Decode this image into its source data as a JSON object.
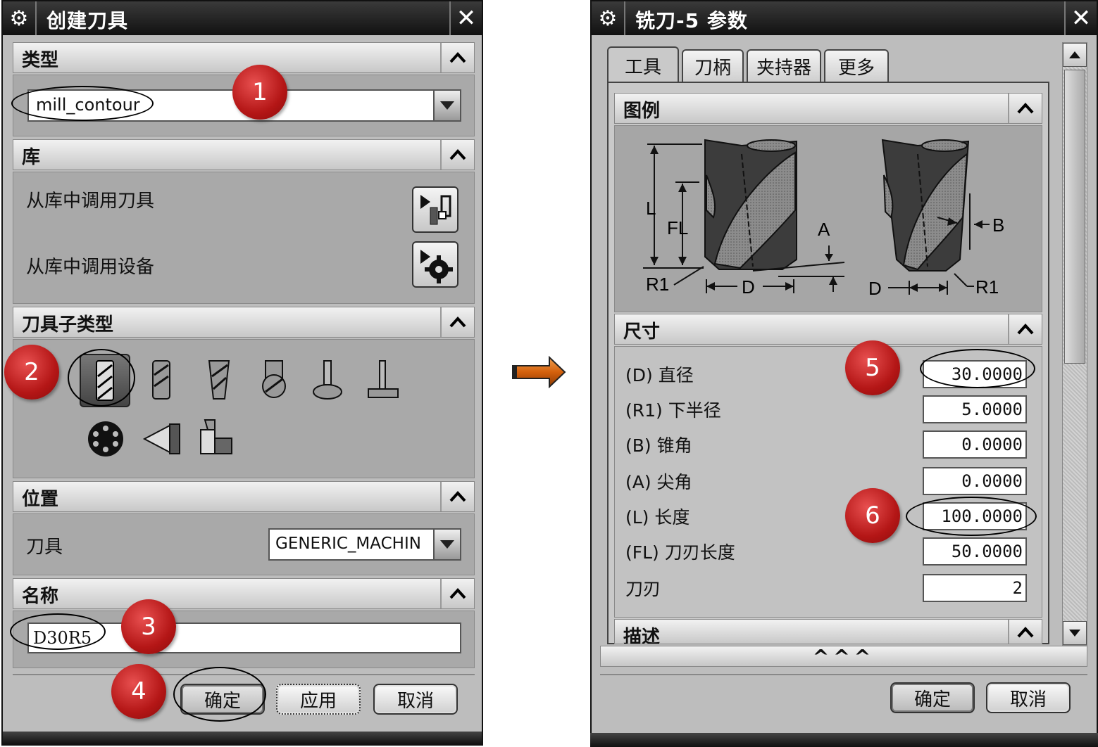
{
  "left_dialog": {
    "title": "创建刀具",
    "sections": {
      "type": {
        "title": "类型",
        "value": "mill_contour"
      },
      "library": {
        "title": "库",
        "retrieve_tool": "从库中调用刀具",
        "retrieve_device": "从库中调用设备"
      },
      "subtype": {
        "title": "刀具子类型"
      },
      "location": {
        "title": "位置",
        "tool_label": "刀具",
        "tool_value": "GENERIC_MACHIN"
      },
      "name": {
        "title": "名称",
        "value": "D30R5"
      }
    },
    "buttons": {
      "ok": "确定",
      "apply": "应用",
      "cancel": "取消"
    }
  },
  "right_dialog": {
    "title": "铣刀-5 参数",
    "tabs": [
      "工具",
      "刀柄",
      "夹持器",
      "更多"
    ],
    "sections": {
      "legend": {
        "title": "图例"
      },
      "dimensions": {
        "title": "尺寸"
      },
      "description": {
        "title": "描述"
      }
    },
    "params": [
      {
        "label": "(D) 直径",
        "value": "30.0000"
      },
      {
        "label": "(R1) 下半径",
        "value": "5.0000"
      },
      {
        "label": "(B) 锥角",
        "value": "0.0000"
      },
      {
        "label": "(A) 尖角",
        "value": "0.0000"
      },
      {
        "label": "(L) 长度",
        "value": "100.0000"
      },
      {
        "label": "(FL) 刀刃长度",
        "value": "50.0000"
      },
      {
        "label": "刀刃",
        "value": "2"
      }
    ],
    "diagram_labels": {
      "L": "L",
      "FL": "FL",
      "A": "A",
      "B": "B",
      "D1": "D",
      "D2": "D",
      "R1a": "R1",
      "R1b": "R1"
    },
    "collapse_glyph": "^^^",
    "buttons": {
      "ok": "确定",
      "cancel": "取消"
    }
  },
  "markers": [
    "1",
    "2",
    "3",
    "4",
    "5",
    "6"
  ],
  "colors": {
    "marker": "#b41616",
    "arrow": "#d4600c",
    "dialog_bg": "#bdbdbd",
    "titlebar": "#1a1a1a"
  }
}
